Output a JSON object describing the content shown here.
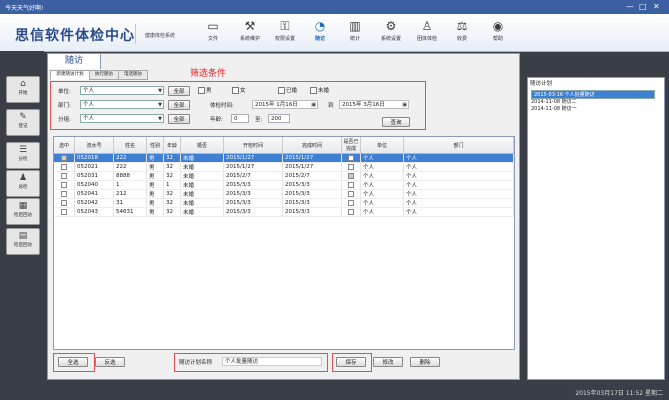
{
  "window": {
    "title": "今天天气好啊!",
    "minimize": "—",
    "maximize": "□",
    "close": "✕"
  },
  "app": {
    "title": "思信软件体检中心",
    "subtitle": "健康体检系统"
  },
  "toolbar": [
    {
      "label": "文件",
      "icon": "file-icon"
    },
    {
      "label": "系统维护",
      "icon": "maintenance-icon"
    },
    {
      "label": "权限设置",
      "icon": "permission-icon"
    },
    {
      "label": "随访",
      "icon": "followup-icon",
      "active": true
    },
    {
      "label": "统计",
      "icon": "chart-icon"
    },
    {
      "label": "系统设置",
      "icon": "settings-icon"
    },
    {
      "label": "团体体检",
      "icon": "group-icon"
    },
    {
      "label": "收费",
      "icon": "money-icon"
    },
    {
      "label": "帮助",
      "icon": "help-icon"
    }
  ],
  "sidebar": [
    {
      "label": "开始",
      "icon": "home-icon"
    },
    {
      "label": "登记",
      "icon": "register-icon"
    },
    {
      "label": "分检",
      "icon": "sort-icon"
    },
    {
      "label": "总检",
      "icon": "summary-icon"
    },
    {
      "label": "检后回访",
      "icon": "revisit-icon"
    },
    {
      "label": "检后回访",
      "icon": "revisit2-icon"
    }
  ],
  "main_tab": "随访",
  "sub_tabs": [
    "新建随访计划",
    "执行随访",
    "电话随访"
  ],
  "filter_caption": "筛选条件",
  "filters": {
    "unit_label": "单位:",
    "unit_value": "个人",
    "unit_all": "全部",
    "dept_label": "部门:",
    "dept_value": "个人",
    "dept_all": "全部",
    "group_label": "分组:",
    "group_value": "个人",
    "group_all": "全部",
    "male": "男",
    "female": "女",
    "married": "已婚",
    "unmarried": "未婚",
    "exam_time_label": "体检时间:",
    "date_from": "2015年 1月16日",
    "to_label": "到",
    "date_to": "2015年 3月16日",
    "age_label": "年龄:",
    "age_from": "0",
    "age_to_label": "至:",
    "age_to": "200",
    "query": "查询"
  },
  "table": {
    "headers": [
      "选中",
      "流水号",
      "姓名",
      "性别",
      "年龄",
      "婚否",
      "开检时间",
      "完成时间",
      "是否已完成",
      "单位",
      "部门"
    ],
    "rows": [
      {
        "checked": true,
        "id": "052018",
        "name": "222",
        "sex": "男",
        "age": "32",
        "married": "未婚",
        "start": "2015/1/27",
        "finish": "2015/1/27",
        "done": false,
        "unit": "个人",
        "dept": "个人",
        "selected": true
      },
      {
        "checked": false,
        "id": "052021",
        "name": "222",
        "sex": "男",
        "age": "32",
        "married": "未婚",
        "start": "2015/1/27",
        "finish": "2015/1/27",
        "done": false,
        "unit": "个人",
        "dept": "个人"
      },
      {
        "checked": false,
        "id": "052031",
        "name": "8888",
        "sex": "男",
        "age": "32",
        "married": "未婚",
        "start": "2015/2/7",
        "finish": "2015/2/7",
        "done": true,
        "unit": "个人",
        "dept": "个人"
      },
      {
        "checked": false,
        "id": "052040",
        "name": "1",
        "sex": "男",
        "age": "1",
        "married": "未婚",
        "start": "2015/3/3",
        "finish": "2015/3/3",
        "done": false,
        "unit": "个人",
        "dept": "个人"
      },
      {
        "checked": false,
        "id": "052041",
        "name": "212",
        "sex": "男",
        "age": "32",
        "married": "未婚",
        "start": "2015/3/3",
        "finish": "2015/3/3",
        "done": false,
        "unit": "个人",
        "dept": "个人"
      },
      {
        "checked": false,
        "id": "052042",
        "name": "31",
        "sex": "男",
        "age": "32",
        "married": "未婚",
        "start": "2015/3/3",
        "finish": "2015/3/3",
        "done": false,
        "unit": "个人",
        "dept": "个人"
      },
      {
        "checked": false,
        "id": "052043",
        "name": "54631",
        "sex": "男",
        "age": "32",
        "married": "未婚",
        "start": "2015/3/3",
        "finish": "2015/3/3",
        "done": false,
        "unit": "个人",
        "dept": "个人"
      }
    ]
  },
  "bottom": {
    "select_all": "全选",
    "invert": "反选",
    "plan_name_label": "随访计划名称",
    "plan_name_value": "个人批量随访",
    "save": "保存",
    "edit": "修改",
    "delete": "删除"
  },
  "plans": {
    "title": "随访计划",
    "items": [
      "2015-03-16 个人批量随访",
      "2014-11-08 随访二",
      "2014-11-08 随访一"
    ]
  },
  "status": {
    "datetime": "2015年03月17日 11:52 星期二"
  }
}
